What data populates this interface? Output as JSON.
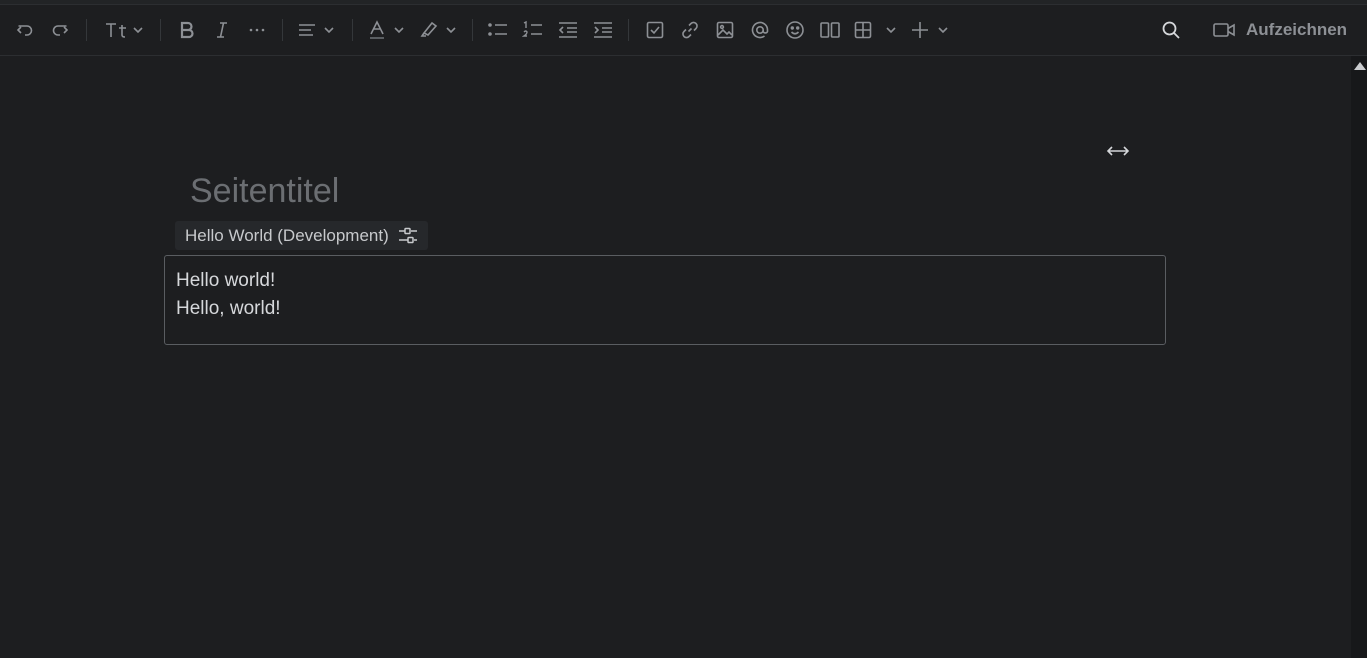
{
  "toolbar": {
    "icons": [
      "undo-icon",
      "redo-icon",
      "text-style-icon",
      "bold-icon",
      "italic-icon",
      "more-formatting-icon",
      "align-icon",
      "text-color-icon",
      "highlight-icon",
      "bullet-list-icon",
      "numbered-list-icon",
      "outdent-icon",
      "indent-icon",
      "task-icon",
      "link-icon",
      "image-icon",
      "mention-icon",
      "emoji-icon",
      "layout-icon",
      "table-icon",
      "insert-icon",
      "search-icon",
      "video-camera-icon"
    ],
    "record_label": "Aufzeichnen"
  },
  "editor": {
    "title_placeholder": "Seitentitel",
    "macro": {
      "name": "Hello World (Development)",
      "lines": [
        "Hello world!",
        "Hello, world!"
      ]
    }
  },
  "colors": {
    "background": "#1d1e20",
    "toolbar_icon": "#8d9095",
    "macro_border": "#5a5d61",
    "placeholder": "#6b6e72"
  }
}
